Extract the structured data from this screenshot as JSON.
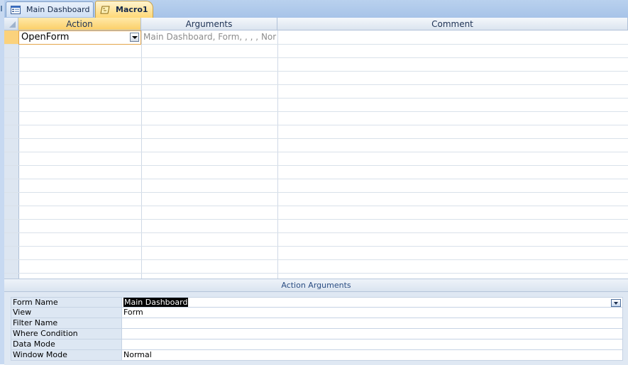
{
  "tabs": [
    {
      "label": "Main Dashboard",
      "icon": "form-icon",
      "active": false
    },
    {
      "label": "Macro1",
      "icon": "macro-icon",
      "active": true
    }
  ],
  "grid": {
    "headers": {
      "action": "Action",
      "arguments": "Arguments",
      "comment": "Comment"
    },
    "rows": [
      {
        "action": "OpenForm",
        "arguments": "Main Dashboard, Form, , , , Normal",
        "comment": ""
      }
    ]
  },
  "action_arguments": {
    "title": "Action Arguments",
    "properties": [
      {
        "label": "Form Name",
        "value": "Main Dashboard"
      },
      {
        "label": "View",
        "value": "Form"
      },
      {
        "label": "Filter Name",
        "value": ""
      },
      {
        "label": "Where Condition",
        "value": ""
      },
      {
        "label": "Data Mode",
        "value": ""
      },
      {
        "label": "Window Mode",
        "value": "Normal"
      }
    ]
  },
  "colors": {
    "accent_active_tab": "#ffd876",
    "header_action": "#fbcf68",
    "pane_background": "#dfe8f3"
  }
}
